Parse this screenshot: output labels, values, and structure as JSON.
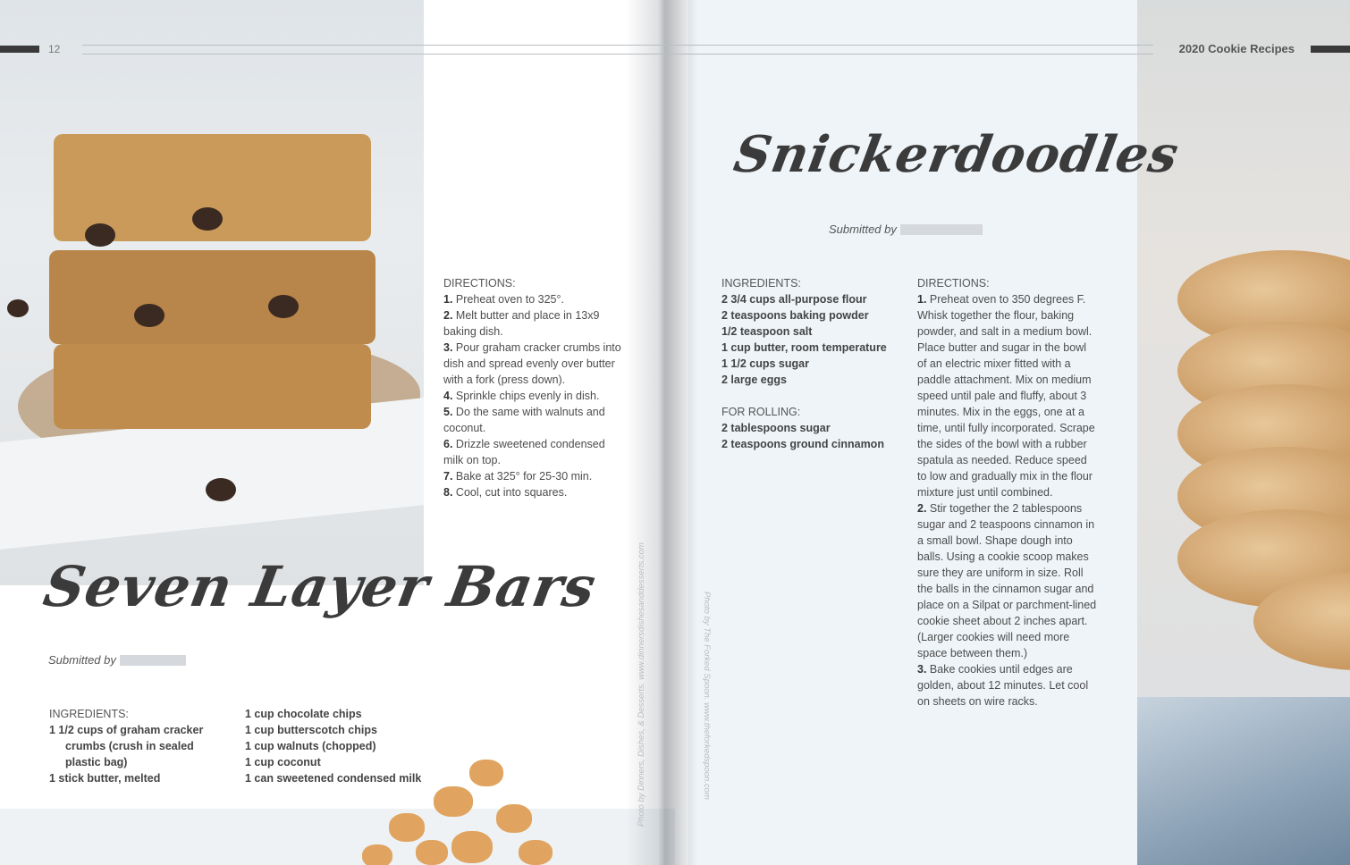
{
  "header": {
    "page_number": "12",
    "running_title": "2020 Cookie Recipes"
  },
  "seven_layer": {
    "title": "Seven Layer Bars",
    "submitted_label": "Submitted by",
    "directions_heading": "DIRECTIONS:",
    "directions": [
      {
        "num": "1.",
        "text": "Preheat oven to 325°."
      },
      {
        "num": "2.",
        "text": "Melt butter and place in 13x9 baking dish."
      },
      {
        "num": "3.",
        "text": "Pour graham cracker crumbs into dish and spread evenly over butter with a fork (press down)."
      },
      {
        "num": "4.",
        "text": "Sprinkle chips evenly in dish."
      },
      {
        "num": "5.",
        "text": "Do the same with walnuts and coconut."
      },
      {
        "num": "6.",
        "text": "Drizzle sweetened condensed milk on top."
      },
      {
        "num": "7.",
        "text": "Bake at 325° for 25-30 min."
      },
      {
        "num": "8.",
        "text": "Cool, cut into squares."
      }
    ],
    "ingredients_heading": "INGREDIENTS:",
    "ingredients_col1": [
      {
        "text": "1 1/2 cups of graham cracker"
      },
      {
        "text": "crumbs (crush in sealed",
        "indent": true
      },
      {
        "text": "plastic bag)",
        "indent": true
      },
      {
        "text": "1 stick butter, melted"
      }
    ],
    "ingredients_col2": [
      "1 cup chocolate chips",
      "1 cup butterscotch chips",
      "1 cup walnuts (chopped)",
      "1 cup coconut",
      "1 can sweetened condensed milk"
    ],
    "photo_credit": "Photo by Dinners, Dishes, & Desserts. www.dinnersdishesanddesserts.com"
  },
  "snickerdoodles": {
    "title": "Snickerdoodles",
    "submitted_label": "Submitted by",
    "ingredients_heading": "INGREDIENTS:",
    "ingredients": [
      "2 3/4 cups all-purpose flour",
      "2 teaspoons baking powder",
      "1/2 teaspoon salt",
      "1 cup butter, room temperature",
      "1 1/2 cups sugar",
      "2 large eggs"
    ],
    "rolling_heading": "FOR ROLLING:",
    "rolling": [
      "2 tablespoons sugar",
      "2 teaspoons ground cinnamon"
    ],
    "directions_heading": "DIRECTIONS:",
    "directions": [
      {
        "num": "1.",
        "text": "Preheat oven to 350 degrees F. Whisk together the flour, baking powder, and salt in a medium bowl. Place butter and sugar in the bowl of an electric mixer fitted with a paddle attachment. Mix on medium speed until pale and fluffy, about 3 minutes. Mix in the eggs, one at a time, until fully incorporated. Scrape the sides of the bowl with a rubber spatula as needed. Reduce speed to low and gradually mix in the flour mixture just until combined."
      },
      {
        "num": "2.",
        "text": "Stir together the 2 tablespoons sugar and 2 teaspoons cinnamon in a small bowl. Shape dough into balls. Using a cookie scoop makes sure they are uniform in size. Roll the balls in the cinnamon sugar and place on a Silpat or parchment-lined cookie sheet about 2 inches apart. (Larger cookies will need more space between them.)"
      },
      {
        "num": "3.",
        "text": "Bake cookies until edges are golden, about 12 minutes. Let cool on sheets on wire racks."
      }
    ],
    "photo_credit": "Photo by The Forked Spoon. www.theforkedspoon.com"
  }
}
